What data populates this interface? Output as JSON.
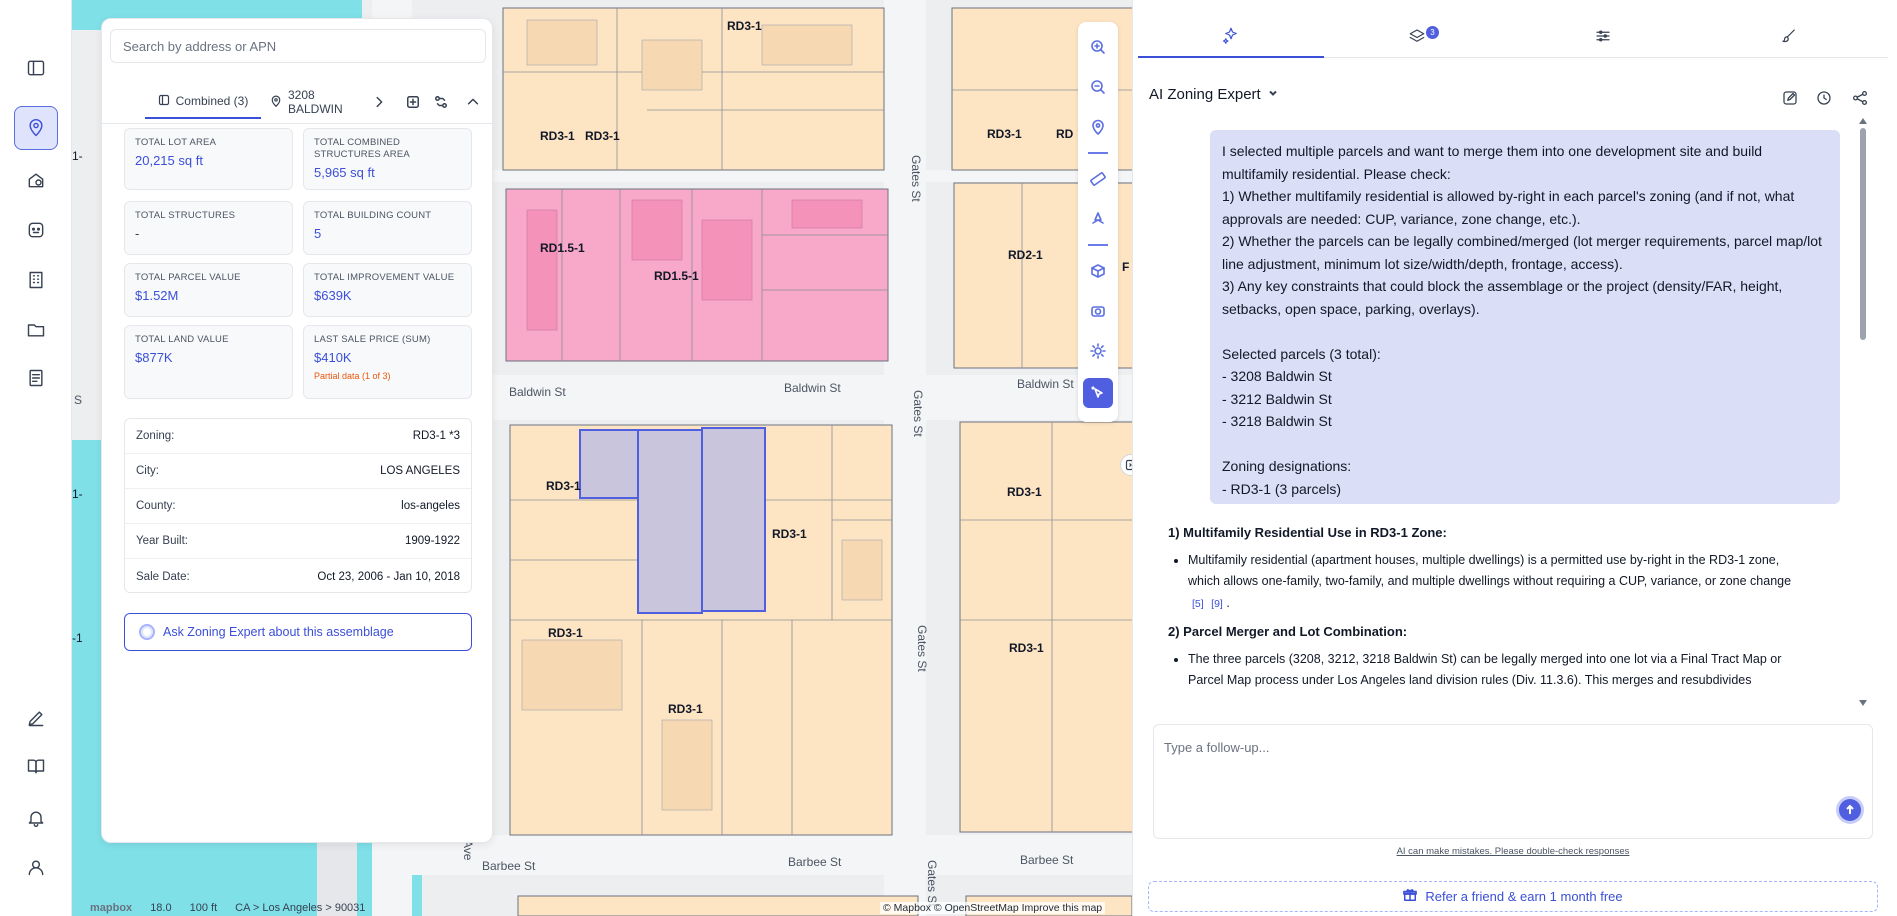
{
  "search": {
    "placeholder": "Search by address or APN"
  },
  "parcel_tabs": [
    {
      "label": "Combined (3)",
      "icon": "group-icon"
    },
    {
      "label": "3208 BALDWIN",
      "icon": "pin-icon"
    }
  ],
  "stats": [
    {
      "label": "TOTAL LOT AREA",
      "value": "20,215 sq ft"
    },
    {
      "label": "TOTAL COMBINED STRUCTURES AREA",
      "value": "5,965 sq ft"
    },
    {
      "label": "TOTAL STRUCTURES",
      "value": "-"
    },
    {
      "label": "TOTAL BUILDING COUNT",
      "value": "5"
    },
    {
      "label": "TOTAL PARCEL VALUE",
      "value": "$1.52M"
    },
    {
      "label": "TOTAL IMPROVEMENT VALUE",
      "value": "$639K"
    },
    {
      "label": "TOTAL LAND VALUE",
      "value": "$877K"
    },
    {
      "label": "LAST SALE PRICE (SUM)",
      "value": "$410K",
      "note": "Partial data (1 of 3)"
    }
  ],
  "details": [
    {
      "key": "Zoning:",
      "value": "RD3-1 *3"
    },
    {
      "key": "City:",
      "value": "LOS ANGELES"
    },
    {
      "key": "County:",
      "value": "los-angeles"
    },
    {
      "key": "Year Built:",
      "value": "1909-1922"
    },
    {
      "key": "Sale Date:",
      "value": "Oct 23, 2006 - Jan 10, 2018"
    }
  ],
  "ask_button": "Ask Zoning Expert about this assemblage",
  "map": {
    "zones": [
      "RD3-1",
      "RD1.5-1",
      "RD2-1",
      "RD"
    ],
    "streets": [
      "Baldwin St",
      "Gates St",
      "Barbee St",
      "Ave"
    ],
    "footer": {
      "logo": "mapbox",
      "zoom": "18.0",
      "scale": "100 ft",
      "breadcrumb": "CA > Los Angeles > 90031"
    },
    "attribution": "© Mapbox © OpenStreetMap  Improve this map",
    "edge_labels": [
      "1-",
      "S",
      "1-",
      "-1",
      "F"
    ]
  },
  "chat": {
    "tabs": [
      {
        "icon": "sparkles-icon"
      },
      {
        "icon": "layers-icon",
        "badge": "3"
      },
      {
        "icon": "sliders-icon"
      },
      {
        "icon": "brush-icon"
      }
    ],
    "expert_name": "AI Zoning Expert",
    "user_message": [
      "I selected multiple parcels and want to merge them into one development site and build multifamily residential. Please check:",
      "1) Whether multifamily residential is allowed by-right in each parcel's zoning (and if not, what approvals are needed: CUP, variance, zone change, etc.).",
      "2) Whether the parcels can be legally combined/merged (lot merger requirements, parcel map/lot line adjustment, minimum lot size/width/depth, frontage, access).",
      "3) Any key constraints that could block the assemblage or the project (density/FAR, height, setbacks, open space, parking, overlays).",
      "",
      "Selected parcels (3 total):",
      "- 3208 Baldwin St",
      "- 3212 Baldwin St",
      "- 3218 Baldwin St",
      "",
      "Zoning designations:",
      "- RD3-1 (3 parcels)"
    ],
    "ai_sections": [
      {
        "heading": "1) Multifamily Residential Use in RD3-1 Zone:",
        "bullet": "Multifamily residential (apartment houses, multiple dwellings) is a permitted use by-right in the RD3-1 zone, which allows one-family, two-family, and multiple dwellings without requiring a CUP, variance, or zone change",
        "cites": [
          "[5]",
          "[9]"
        ],
        "tail": "."
      },
      {
        "heading": "2) Parcel Merger and Lot Combination:",
        "bullet": "The three parcels (3208, 3212, 3218 Baldwin St) can be legally merged into one lot via a Final Tract Map or Parcel Map process under Los Angeles land division rules (Div. 11.3.6). This merges and resubdivides",
        "cites": [],
        "tail": ""
      }
    ],
    "followup_placeholder": "Type a follow-up...",
    "disclaimer": "AI can make mistakes. Please double-check responses",
    "refer": "Refer a friend & earn 1 month free"
  },
  "colors": {
    "accent": "#3b4fd8",
    "rd3_fill": "#fde5c4",
    "rd15_fill": "#f8a8c8",
    "water": "#7fe0e8",
    "selected": "#c9c5dc"
  }
}
